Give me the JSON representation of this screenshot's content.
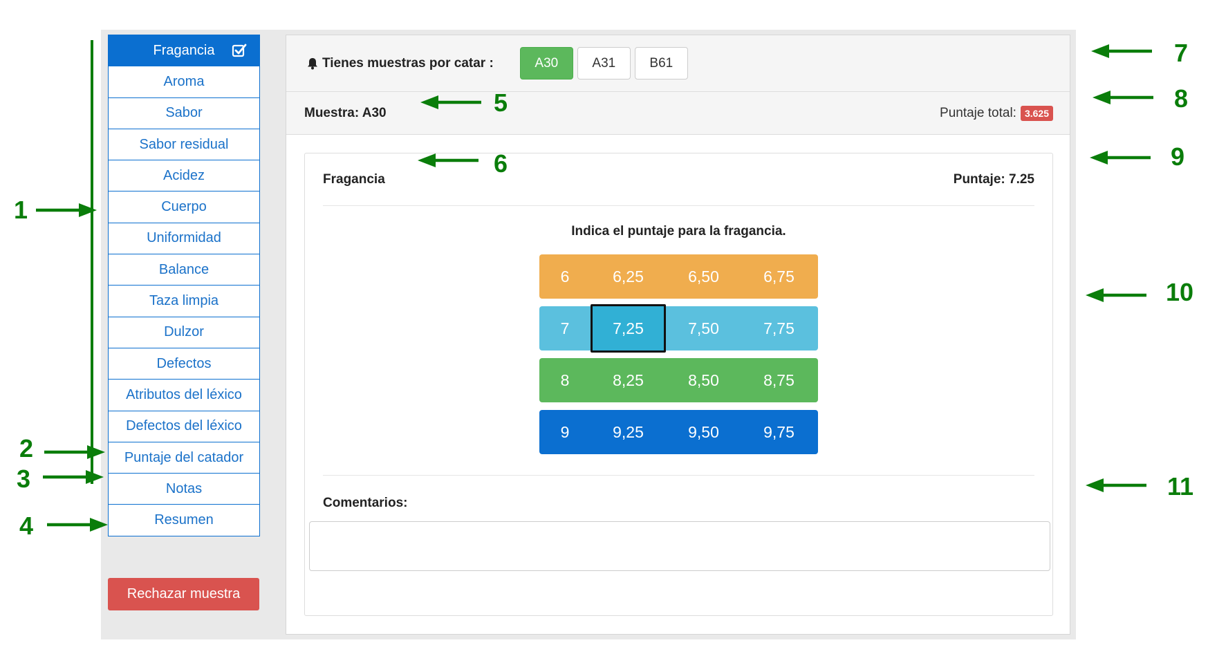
{
  "sidebar": {
    "items": [
      {
        "label": "Fragancia",
        "active": true
      },
      {
        "label": "Aroma"
      },
      {
        "label": "Sabor"
      },
      {
        "label": "Sabor residual"
      },
      {
        "label": "Acidez"
      },
      {
        "label": "Cuerpo"
      },
      {
        "label": "Uniformidad"
      },
      {
        "label": "Balance"
      },
      {
        "label": "Taza limpia"
      },
      {
        "label": "Dulzor"
      },
      {
        "label": "Defectos"
      },
      {
        "label": "Atributos del léxico"
      },
      {
        "label": "Defectos del léxico"
      },
      {
        "label": "Puntaje del catador"
      },
      {
        "label": "Notas"
      },
      {
        "label": "Resumen"
      }
    ],
    "reject_label": "Rechazar muestra"
  },
  "samples": {
    "label": "Tienes muestras por catar :",
    "items": [
      "A30",
      "A31",
      "B61"
    ],
    "active": "A30"
  },
  "sample_header": {
    "title": "Muestra: A30",
    "total_label": "Puntaje total:",
    "total_value": "3.625"
  },
  "card": {
    "title": "Fragancia",
    "score": "Puntaje: 7.25",
    "instruction": "Indica el puntaje para la fragancia.",
    "grid": [
      [
        "6",
        "6,25",
        "6,50",
        "6,75"
      ],
      [
        "7",
        "7,25",
        "7,50",
        "7,75"
      ],
      [
        "8",
        "8,25",
        "8,50",
        "8,75"
      ],
      [
        "9",
        "9,25",
        "9,50",
        "9,75"
      ]
    ],
    "selected": "7,25",
    "comments_label": "Comentarios:",
    "comments_value": ""
  },
  "annotations": [
    "1",
    "2",
    "3",
    "4",
    "5",
    "6",
    "7",
    "8",
    "9",
    "10",
    "11"
  ],
  "colors": {
    "primary": "#0b6fd0",
    "success": "#5cb85c",
    "warning": "#f0ad4e",
    "info": "#5bc0de",
    "danger": "#d9534f",
    "annotation": "#0a7d0a"
  }
}
